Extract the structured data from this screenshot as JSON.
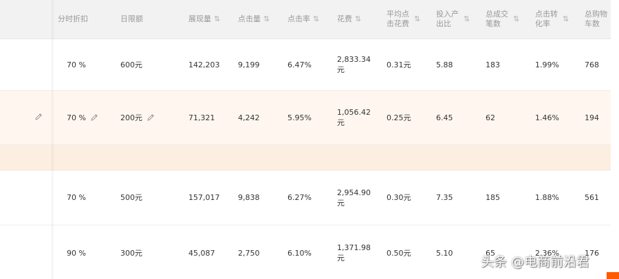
{
  "table": {
    "columns": [
      {
        "label": "分时折扣",
        "sortable": false
      },
      {
        "label": "日限额",
        "sortable": false
      },
      {
        "label": "展现量",
        "sortable": true
      },
      {
        "label": "点击量",
        "sortable": true
      },
      {
        "label": "点击率",
        "sortable": true
      },
      {
        "label": "花费",
        "sortable": true
      },
      {
        "label": "平均点击花费",
        "sortable": true
      },
      {
        "label": "投入产出比",
        "sortable": true
      },
      {
        "label": "总成交笔数",
        "sortable": true
      },
      {
        "label": "点击转化率",
        "sortable": true
      },
      {
        "label": "总购物车数",
        "sortable": false
      }
    ],
    "sort_glyph": "⇅",
    "rows": [
      [
        "70 %",
        "600元",
        "142,203",
        "9,199",
        "6.47%",
        "2,833.34元",
        "0.31元",
        "5.88",
        "183",
        "1.99%",
        "768"
      ],
      [
        "70 %",
        "200元",
        "71,321",
        "4,242",
        "5.95%",
        "1,056.42元",
        "0.25元",
        "6.45",
        "62",
        "1.46%",
        "194"
      ],
      [
        "70 %",
        "500元",
        "157,017",
        "9,838",
        "6.27%",
        "2,954.90元",
        "0.30元",
        "7.35",
        "185",
        "1.88%",
        "561"
      ],
      [
        "90 %",
        "300元",
        "45,087",
        "2,750",
        "6.10%",
        "1,371.98元",
        "0.50元",
        "5.10",
        "65",
        "2.36%",
        "176"
      ]
    ]
  },
  "watermark": {
    "text": "头条 @电商前沿君"
  },
  "colors": {
    "accent": "#ff5a00",
    "header_bg": "#f2f2f2",
    "highlight_row": "#fff7ef",
    "sub_row": "#fdeee2"
  }
}
